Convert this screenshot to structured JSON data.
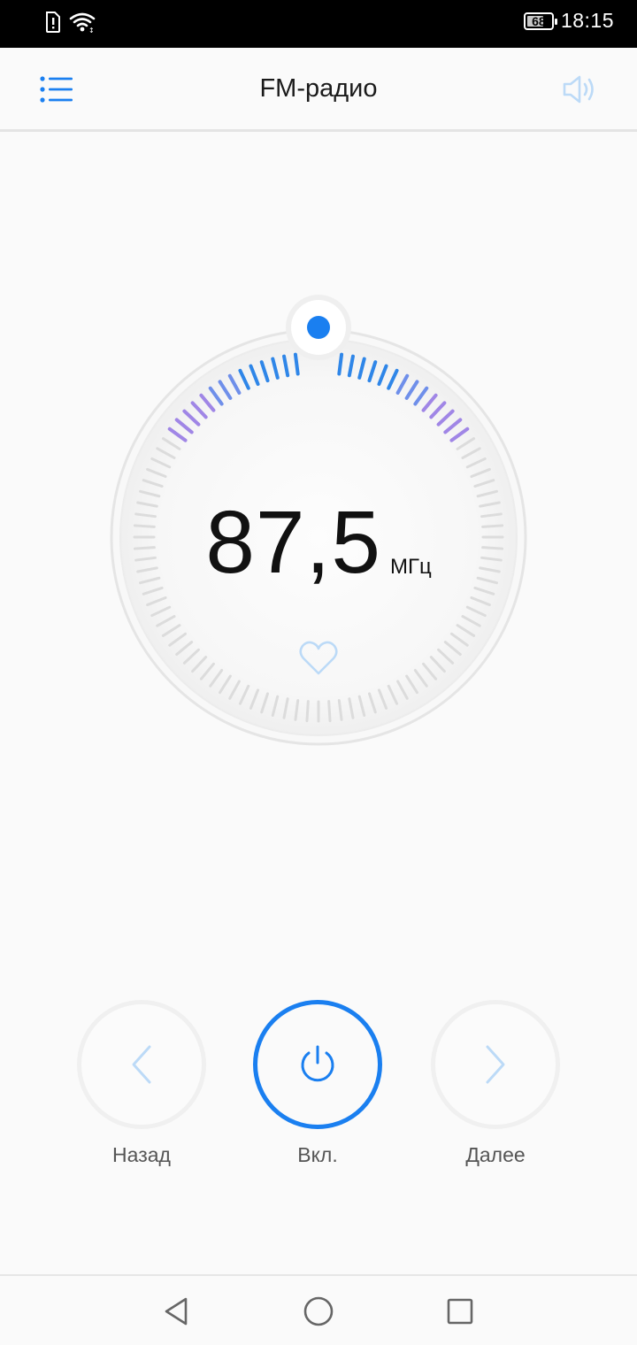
{
  "status_bar": {
    "icons": [
      "sim-alert-icon",
      "wifi-icon"
    ],
    "battery_level": "68",
    "time": "18:15"
  },
  "app_bar": {
    "title": "FM-радио",
    "menu_icon": "list-icon",
    "volume_icon": "speaker-icon"
  },
  "tuner": {
    "frequency": "87,5",
    "unit": "МГц",
    "favorite_icon": "heart-icon",
    "position_fraction": 0.0
  },
  "controls": {
    "prev_label": "Назад",
    "power_label": "Вкл.",
    "next_label": "Далее"
  },
  "nav_bar": {
    "icons": [
      "back-icon",
      "home-icon",
      "recents-icon"
    ]
  },
  "colors": {
    "accent": "#1a7ff0",
    "accent_light": "#bcdaf7",
    "scale_purple": "#a086e6",
    "scale_blue": "#2f86e8",
    "scale_gray": "#dcdcdc"
  }
}
